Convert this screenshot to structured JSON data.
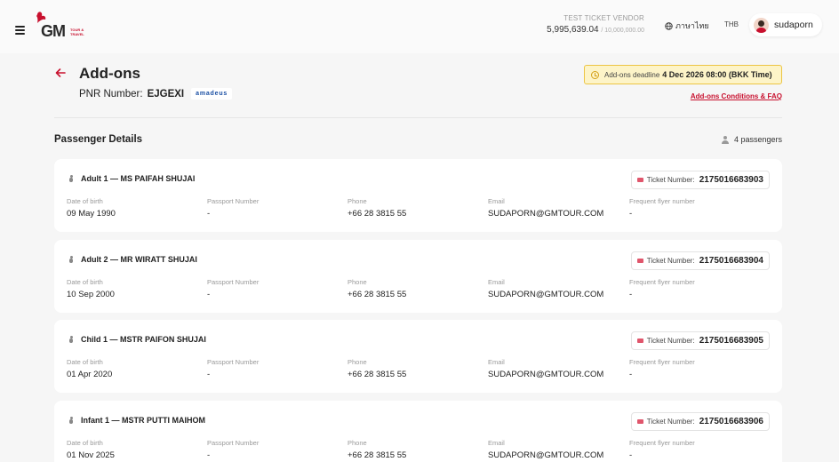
{
  "header": {
    "vendor_name": "TEST TICKET VENDOR",
    "balance": "5,995,639.04",
    "balance_max": "/ 10,000,000.00",
    "language": "ภาษาไทย",
    "currency": "THB",
    "username": "sudaporn",
    "logo_text": "GM",
    "logo_sub": "TOUR & TRAVEL"
  },
  "page": {
    "title": "Add-ons",
    "pnr_label": "PNR Number:",
    "pnr_value": "EJGEXI",
    "gds": "amadeus",
    "deadline_label": "Add-ons deadline",
    "deadline_value": "4 Dec 2026 08:00 (BKK Time)",
    "faq_link": "Add-ons Conditions & FAQ"
  },
  "passengers_section": {
    "title": "Passenger Details",
    "count": "4 passengers",
    "field_labels": {
      "dob": "Date of birth",
      "passport": "Passport Number",
      "phone": "Phone",
      "email": "Email",
      "ffn": "Frequent flyer number"
    },
    "ticket_label": "Ticket Number:",
    "items": [
      {
        "title": "Adult 1 — MS PAIFAH SHUJAI",
        "ticket": "2175016683903",
        "dob": "09 May 1990",
        "passport": "-",
        "phone": "+66 28 3815 55",
        "email": "SUDAPORN@GMTOUR.COM",
        "ffn": "-"
      },
      {
        "title": "Adult 2 — MR WIRATT SHUJAI",
        "ticket": "2175016683904",
        "dob": "10 Sep 2000",
        "passport": "-",
        "phone": "+66 28 3815 55",
        "email": "SUDAPORN@GMTOUR.COM",
        "ffn": "-"
      },
      {
        "title": "Child 1 — MSTR PAIFON SHUJAI",
        "ticket": "2175016683905",
        "dob": "01 Apr 2020",
        "passport": "-",
        "phone": "+66 28 3815 55",
        "email": "SUDAPORN@GMTOUR.COM",
        "ffn": "-"
      },
      {
        "title": "Infant 1 — MSTR PUTTI MAIHOM",
        "ticket": "2175016683906",
        "dob": "01 Nov 2025",
        "passport": "-",
        "phone": "+66 28 3815 55",
        "email": "SUDAPORN@GMTOUR.COM",
        "ffn": "-"
      }
    ]
  },
  "colors": {
    "brand": "#c8102e",
    "deadline_bg": "#fdf4c8",
    "deadline_border": "#ecc544"
  }
}
